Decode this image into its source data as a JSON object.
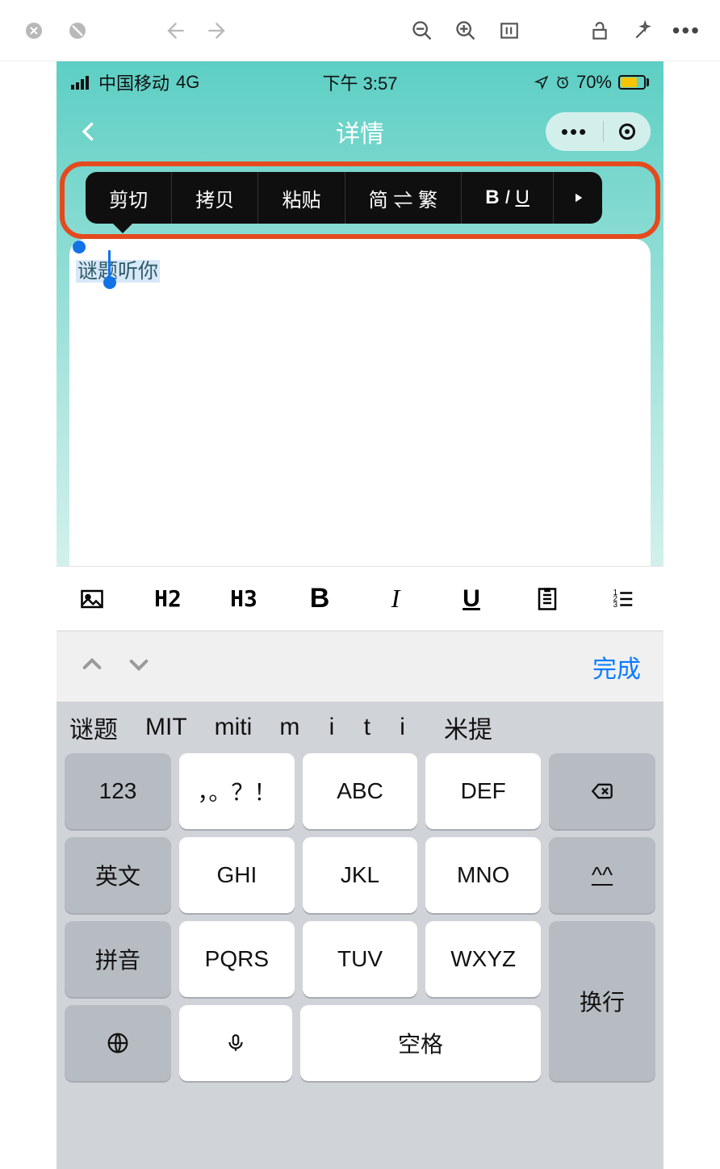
{
  "status": {
    "carrier": "中国移动",
    "net": "4G",
    "time": "下午 3:57",
    "battery_pct": "70%"
  },
  "nav": {
    "title": "详情"
  },
  "context_menu": {
    "cut": "剪切",
    "copy": "拷贝",
    "paste": "粘贴",
    "convert": "简 ⇌ 繁"
  },
  "content": {
    "text": "谜题听你"
  },
  "editor_toolbar": {
    "h2": "H2",
    "h3": "H3"
  },
  "accessory": {
    "done": "完成"
  },
  "keyboard": {
    "candidates": [
      "谜题",
      "MIT",
      "miti",
      "m i t i",
      "米提"
    ],
    "keys": {
      "k123": "123",
      "punct": "，。？！",
      "abc": "ABC",
      "def": "DEF",
      "eng": "英文",
      "ghi": "GHI",
      "jkl": "JKL",
      "mno": "MNO",
      "face": "^^",
      "pinyin": "拼音",
      "pqrs": "PQRS",
      "tuv": "TUV",
      "wxyz": "WXYZ",
      "enter": "换行",
      "space": "空格"
    }
  }
}
